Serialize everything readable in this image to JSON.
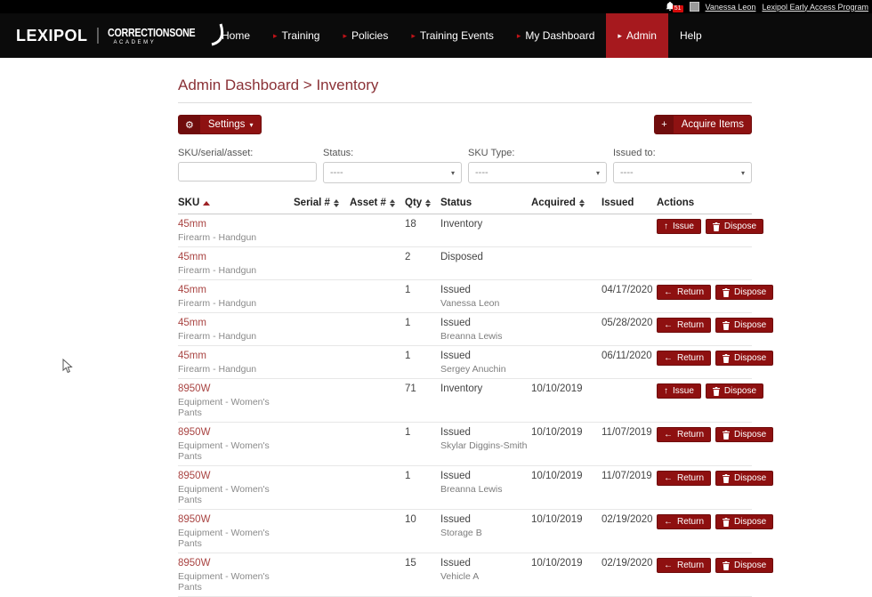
{
  "topbar": {
    "notification_count": "51",
    "user_name": "Vanessa Leon",
    "program_link": "Lexipol Early Access Program"
  },
  "nav": {
    "brand": {
      "primary": "LEXIPOL",
      "secondary": "CORRECTIONSONE",
      "tertiary": "ACADEMY"
    },
    "items": [
      {
        "label": "Home",
        "arrow": false,
        "active": false
      },
      {
        "label": "Training",
        "arrow": true,
        "active": false
      },
      {
        "label": "Policies",
        "arrow": true,
        "active": false
      },
      {
        "label": "Training Events",
        "arrow": true,
        "active": false
      },
      {
        "label": "My Dashboard",
        "arrow": true,
        "active": false
      },
      {
        "label": "Admin",
        "arrow": true,
        "active": true
      },
      {
        "label": "Help",
        "arrow": false,
        "active": false
      }
    ]
  },
  "page": {
    "title": "Admin Dashboard > Inventory",
    "settings_label": "Settings",
    "acquire_label": "Acquire Items"
  },
  "icons": {
    "gear": "⚙",
    "caret_down": "▾",
    "plus": "+",
    "nav_arrow": "▸",
    "select_caret": "▾",
    "issue_arrow": "↑",
    "return_arrow": "←"
  },
  "filters": {
    "sku": {
      "label": "SKU/serial/asset:",
      "value": "",
      "placeholder": ""
    },
    "status": {
      "label": "Status:",
      "value": "----"
    },
    "sku_type": {
      "label": "SKU Type:",
      "value": "----"
    },
    "issued_to": {
      "label": "Issued to:",
      "value": "----"
    }
  },
  "actions": {
    "issue": "Issue",
    "return": "Return",
    "dispose": "Dispose"
  },
  "table": {
    "headers": [
      {
        "label": "SKU",
        "sort": "asc"
      },
      {
        "label": "Serial #",
        "sort": "both"
      },
      {
        "label": "Asset #",
        "sort": "both"
      },
      {
        "label": "Qty",
        "sort": "both"
      },
      {
        "label": "Status",
        "sort": null
      },
      {
        "label": "Acquired",
        "sort": "both"
      },
      {
        "label": "Issued",
        "sort": null
      },
      {
        "label": "Actions",
        "sort": null
      }
    ],
    "rows": [
      {
        "sku": "45mm",
        "category": "Firearm - Handgun",
        "serial": "",
        "asset": "",
        "qty": "18",
        "status": "Inventory",
        "status_sub": "",
        "acquired": "",
        "issued": "",
        "actions": [
          "issue",
          "dispose"
        ]
      },
      {
        "sku": "45mm",
        "category": "Firearm - Handgun",
        "serial": "",
        "asset": "",
        "qty": "2",
        "status": "Disposed",
        "status_sub": "",
        "acquired": "",
        "issued": "",
        "actions": []
      },
      {
        "sku": "45mm",
        "category": "Firearm - Handgun",
        "serial": "",
        "asset": "",
        "qty": "1",
        "status": "Issued",
        "status_sub": "Vanessa Leon",
        "acquired": "",
        "issued": "04/17/2020",
        "actions": [
          "return",
          "dispose"
        ]
      },
      {
        "sku": "45mm",
        "category": "Firearm - Handgun",
        "serial": "",
        "asset": "",
        "qty": "1",
        "status": "Issued",
        "status_sub": "Breanna Lewis",
        "acquired": "",
        "issued": "05/28/2020",
        "actions": [
          "return",
          "dispose"
        ]
      },
      {
        "sku": "45mm",
        "category": "Firearm - Handgun",
        "serial": "",
        "asset": "",
        "qty": "1",
        "status": "Issued",
        "status_sub": "Sergey Anuchin",
        "acquired": "",
        "issued": "06/11/2020",
        "actions": [
          "return",
          "dispose"
        ]
      },
      {
        "sku": "8950W",
        "category": "Equipment - Women's Pants",
        "serial": "",
        "asset": "",
        "qty": "71",
        "status": "Inventory",
        "status_sub": "",
        "acquired": "10/10/2019",
        "issued": "",
        "actions": [
          "issue",
          "dispose"
        ]
      },
      {
        "sku": "8950W",
        "category": "Equipment - Women's Pants",
        "serial": "",
        "asset": "",
        "qty": "1",
        "status": "Issued",
        "status_sub": "Skylar Diggins-Smith",
        "acquired": "10/10/2019",
        "issued": "11/07/2019",
        "actions": [
          "return",
          "dispose"
        ]
      },
      {
        "sku": "8950W",
        "category": "Equipment - Women's Pants",
        "serial": "",
        "asset": "",
        "qty": "1",
        "status": "Issued",
        "status_sub": "Breanna Lewis",
        "acquired": "10/10/2019",
        "issued": "11/07/2019",
        "actions": [
          "return",
          "dispose"
        ]
      },
      {
        "sku": "8950W",
        "category": "Equipment - Women's Pants",
        "serial": "",
        "asset": "",
        "qty": "10",
        "status": "Issued",
        "status_sub": "Storage B",
        "acquired": "10/10/2019",
        "issued": "02/19/2020",
        "actions": [
          "return",
          "dispose"
        ]
      },
      {
        "sku": "8950W",
        "category": "Equipment - Women's Pants",
        "serial": "",
        "asset": "",
        "qty": "15",
        "status": "Issued",
        "status_sub": "Vehicle A",
        "acquired": "10/10/2019",
        "issued": "02/19/2020",
        "actions": [
          "return",
          "dispose"
        ]
      }
    ]
  },
  "colors": {
    "nav_black": "#0b0b0b",
    "active_tab_red": "#a6191e",
    "button_red": "#8e1212",
    "button_red_dark": "#700d0d",
    "heading_maroon": "#8a3136",
    "sku_link_red": "#a94442",
    "badge_red": "#d40b0b"
  }
}
